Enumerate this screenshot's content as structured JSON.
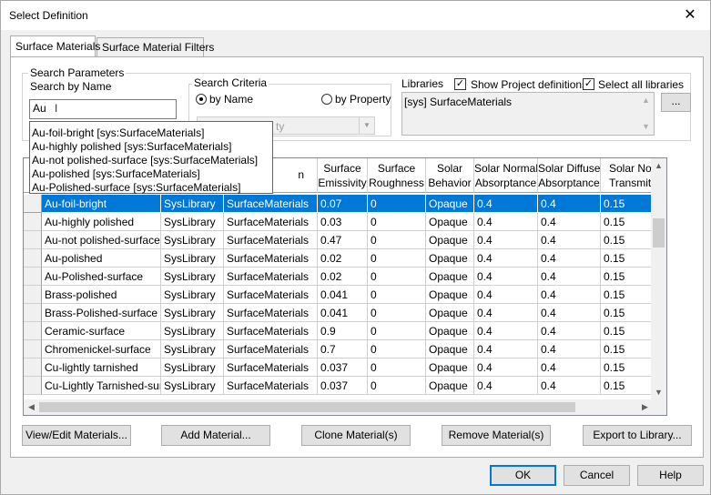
{
  "window": {
    "title": "Select Definition",
    "close_glyph": "✕"
  },
  "tabs": [
    {
      "label": "Surface Materials"
    },
    {
      "label": "Surface Material Filters"
    }
  ],
  "search": {
    "group_label": "Search Parameters",
    "by_name_label": "Search by Name",
    "input_value": "Au",
    "cursor_glyph": "I",
    "criteria_label": "Search Criteria",
    "by_name_option": "by Name",
    "by_property_option": "by Property",
    "property_placeholder": "ty",
    "combo_arrow": "▼"
  },
  "libraries": {
    "label": "Libraries",
    "show_project_label": "Show Project definitions",
    "show_project_checked": true,
    "select_all_label": "Select all libraries",
    "select_all_checked": true,
    "check_glyph": "✓",
    "items": [
      "[sys] SurfaceMaterials"
    ],
    "browse_label": "...",
    "up_arrow": "▲",
    "down_arrow": "▼"
  },
  "autocomplete": [
    "Au-foil-bright [sys:SurfaceMaterials]",
    "Au-highly polished [sys:SurfaceMaterials]",
    "Au-not polished-surface [sys:SurfaceMaterials]",
    "Au-polished [sys:SurfaceMaterials]",
    "Au-Polished-surface [sys:SurfaceMaterials]"
  ],
  "grid": {
    "headers": [
      "",
      "",
      "",
      "n",
      "Surface\nEmissivity",
      "Surface\nRoughness",
      "Solar\nBehavior",
      "Solar Normal\nAbsorptance",
      "Solar Diffuse\nAbsorptance",
      "Solar Norm\nTransmittan"
    ],
    "rows": [
      [
        "Au-foil-bright",
        "SysLibrary",
        "SurfaceMaterials",
        "0.07",
        "0",
        "Opaque",
        "0.4",
        "0.4",
        "0.15"
      ],
      [
        "Au-highly polished",
        "SysLibrary",
        "SurfaceMaterials",
        "0.03",
        "0",
        "Opaque",
        "0.4",
        "0.4",
        "0.15"
      ],
      [
        "Au-not polished-surface",
        "SysLibrary",
        "SurfaceMaterials",
        "0.47",
        "0",
        "Opaque",
        "0.4",
        "0.4",
        "0.15"
      ],
      [
        "Au-polished",
        "SysLibrary",
        "SurfaceMaterials",
        "0.02",
        "0",
        "Opaque",
        "0.4",
        "0.4",
        "0.15"
      ],
      [
        "Au-Polished-surface",
        "SysLibrary",
        "SurfaceMaterials",
        "0.02",
        "0",
        "Opaque",
        "0.4",
        "0.4",
        "0.15"
      ],
      [
        "Brass-polished",
        "SysLibrary",
        "SurfaceMaterials",
        "0.041",
        "0",
        "Opaque",
        "0.4",
        "0.4",
        "0.15"
      ],
      [
        "Brass-Polished-surface",
        "SysLibrary",
        "SurfaceMaterials",
        "0.041",
        "0",
        "Opaque",
        "0.4",
        "0.4",
        "0.15"
      ],
      [
        "Ceramic-surface",
        "SysLibrary",
        "SurfaceMaterials",
        "0.9",
        "0",
        "Opaque",
        "0.4",
        "0.4",
        "0.15"
      ],
      [
        "Chromenickel-surface",
        "SysLibrary",
        "SurfaceMaterials",
        "0.7",
        "0",
        "Opaque",
        "0.4",
        "0.4",
        "0.15"
      ],
      [
        "Cu-lightly tarnished",
        "SysLibrary",
        "SurfaceMaterials",
        "0.037",
        "0",
        "Opaque",
        "0.4",
        "0.4",
        "0.15"
      ],
      [
        "Cu-Lightly Tarnished-surf...",
        "SysLibrary",
        "SurfaceMaterials",
        "0.037",
        "0",
        "Opaque",
        "0.4",
        "0.4",
        "0.15"
      ]
    ],
    "selected_row": 0,
    "scroll_up": "▲",
    "scroll_down": "▼",
    "scroll_left": "◀",
    "scroll_right": "▶"
  },
  "buttons": {
    "view_edit": "View/Edit Materials...",
    "add": "Add Material...",
    "clone": "Clone Material(s)",
    "remove": "Remove Material(s)",
    "export": "Export to Library...",
    "ok": "OK",
    "cancel": "Cancel",
    "help": "Help"
  },
  "colors": {
    "selection": "#0078d7",
    "dialog_bg": "#f0f0f0"
  }
}
